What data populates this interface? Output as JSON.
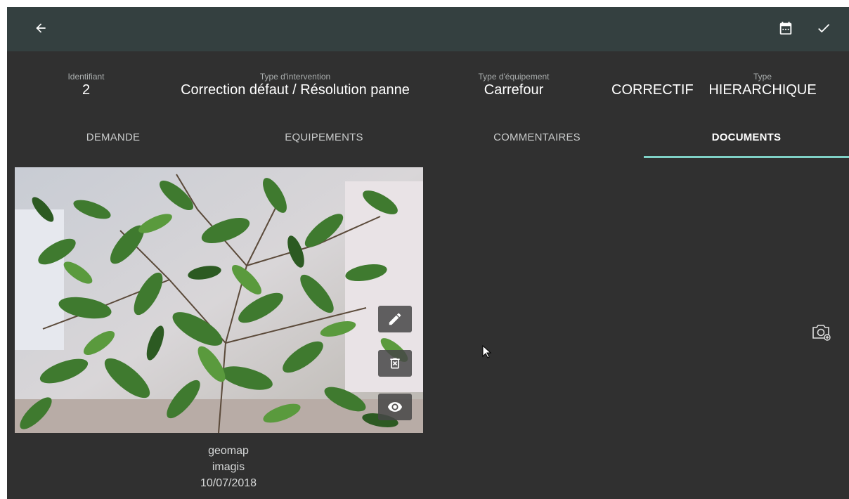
{
  "header": {
    "identifiant_label": "Identifiant",
    "identifiant_value": "2",
    "type_intervention_label": "Type d'intervention",
    "type_intervention_value": "Correction défaut / Résolution panne",
    "type_equipement_label": "Type d'équipement",
    "type_equipement_value": "Carrefour",
    "classification_value": "CORRECTIF",
    "type_label": "Type",
    "type_value": "HIERARCHIQUE"
  },
  "tabs": [
    {
      "label": "DEMANDE",
      "active": false
    },
    {
      "label": "EQUIPEMENTS",
      "active": false
    },
    {
      "label": "COMMENTAIRES",
      "active": false
    },
    {
      "label": "DOCUMENTS",
      "active": true
    }
  ],
  "document": {
    "author": "geomap",
    "organisation": "imagis",
    "date": "10/07/2018"
  },
  "icons": {
    "back": "arrow-left-icon",
    "calendar": "calendar-icon",
    "validate": "check-icon",
    "edit": "pencil-icon",
    "delete": "delete-icon",
    "view": "eye-icon",
    "add_photo": "camera-add-icon"
  },
  "colors": {
    "topbar": "#344040",
    "background": "#303030",
    "tab_indicator": "#7fd1c6"
  }
}
